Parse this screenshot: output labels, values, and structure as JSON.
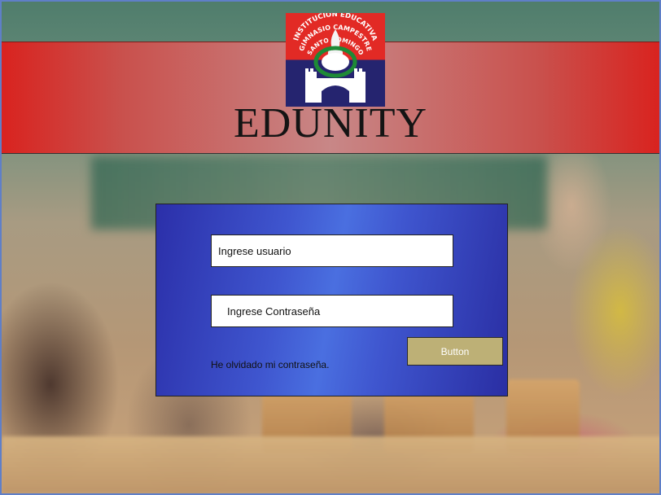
{
  "header": {
    "title": "EDUNITY",
    "logo": {
      "line1": "INSTITUCIÓN EDUCATIVA",
      "line2": "GIMNASIO CAMPESTRE",
      "line3": "SANTO DOMINGO"
    }
  },
  "login": {
    "username_placeholder": "Ingrese usuario",
    "password_placeholder": "Ingrese Contraseña",
    "button_label": "Button",
    "forgot_label": "He olvidado mi contraseña."
  },
  "colors": {
    "header_red": "#d9231f",
    "panel_blue": "#3f56cf",
    "button_gold": "#bdb076"
  }
}
